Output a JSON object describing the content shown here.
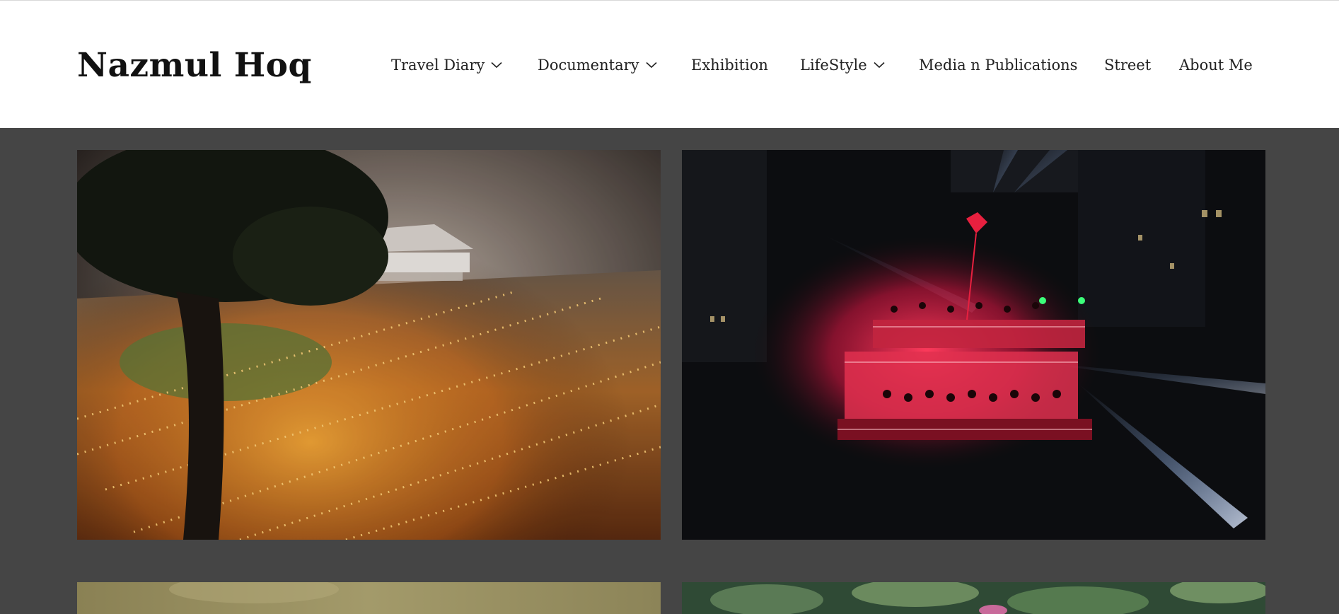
{
  "site": {
    "title": "Nazmul Hoq"
  },
  "nav": {
    "items": [
      {
        "label": "Travel Diary",
        "has_dropdown": true
      },
      {
        "label": "Documentary",
        "has_dropdown": true
      },
      {
        "label": "Exhibition",
        "has_dropdown": false
      },
      {
        "label": "LifeStyle",
        "has_dropdown": true
      },
      {
        "label": "Media n Publications",
        "has_dropdown": false
      },
      {
        "label": "Street",
        "has_dropdown": false
      },
      {
        "label": "About Me",
        "has_dropdown": false
      }
    ]
  },
  "gallery": {
    "background_color": "#454545",
    "photos": [
      {
        "subject": "night gathering with candle-lit crowd in fog beside a tree and pavilion"
      },
      {
        "subject": "rooftop stage lit red at night with spotlight beams over a dark city"
      },
      {
        "subject": "muted olive-toned photo (partially visible)"
      },
      {
        "subject": "green leaves / lily pads (partially visible)"
      }
    ]
  },
  "colors": {
    "header_bg": "#ffffff",
    "page_bg": "#454545",
    "title_text": "#111111",
    "nav_text": "#222222"
  }
}
